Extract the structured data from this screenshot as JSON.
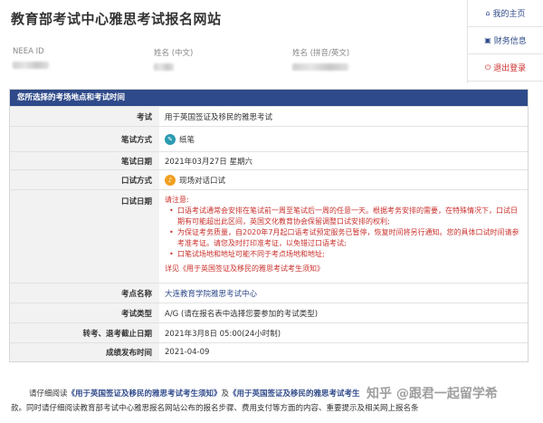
{
  "header": {
    "title": "教育部考试中心雅思考试报名网站",
    "neea_label": "NEEA ID",
    "name_cn_label": "姓名 (中文)",
    "name_en_label": "姓名 (拼音/英文)"
  },
  "sidebar": {
    "items": [
      {
        "label": "我的主页",
        "icon": "home-icon"
      },
      {
        "label": "财务信息",
        "icon": "briefcase-icon"
      },
      {
        "label": "退出登录",
        "icon": "power-icon"
      }
    ]
  },
  "panel": {
    "title": "您所选择的考场地点和考试时间",
    "rows": {
      "exam": {
        "label": "考试",
        "value": "用于英国签证及移民的雅思考试"
      },
      "mode": {
        "label": "笔试方式",
        "value": "纸笔"
      },
      "written_date": {
        "label": "笔试日期",
        "value": "2021年03月27日 星期六"
      },
      "oral_mode": {
        "label": "口试方式",
        "value": "现场对话口试"
      },
      "oral_date": {
        "label": "口试日期",
        "notice_title": "请注意:",
        "notes": [
          "口语考试通常会安排在笔试前一周至笔试后一周的任意一天。根据考务安排的需要，在特殊情况下，口试日期有可能超出此区间，英国文化教育协会保留调整口试安排的权利;",
          "为保证考务质量，自2020年7月起口语考试预定服务已暂停，恢复时间将另行通知。您的具体口试时间请参考准考证。请您及时打印准考证，以免错过口语考试;",
          "口笔试场地和地址可能不同于考点场地和地址;"
        ],
        "detail_prefix": "详见",
        "detail_link": "《用于英国签证及移民的雅思考试考生须知》"
      },
      "venue": {
        "label": "考点名称",
        "value": "大连教育学院雅思考试中心"
      },
      "type": {
        "label": "考试类型",
        "value": "A/G (请在报名表中选择您要参加的考试类型)"
      },
      "deadline": {
        "label": "转考、退考截止日期",
        "value": "2021年3月8日 05:00(24小时制)"
      },
      "results": {
        "label": "成绩发布时间",
        "value": "2021-04-09"
      }
    }
  },
  "bottom": {
    "prefix": "请仔细阅读",
    "link1": "《用于英国签证及移民的雅思考试考生须知》",
    "and": "及",
    "link2": "《用于英国签证及移民的雅思考试考生",
    "line2": "款。同时请仔细阅读教育部考试中心雅思报名网站公布的报名步骤、费用支付等方面的内容、重要提示及相关网上报名条"
  },
  "watermark": "知乎 @跟君一起留学希"
}
